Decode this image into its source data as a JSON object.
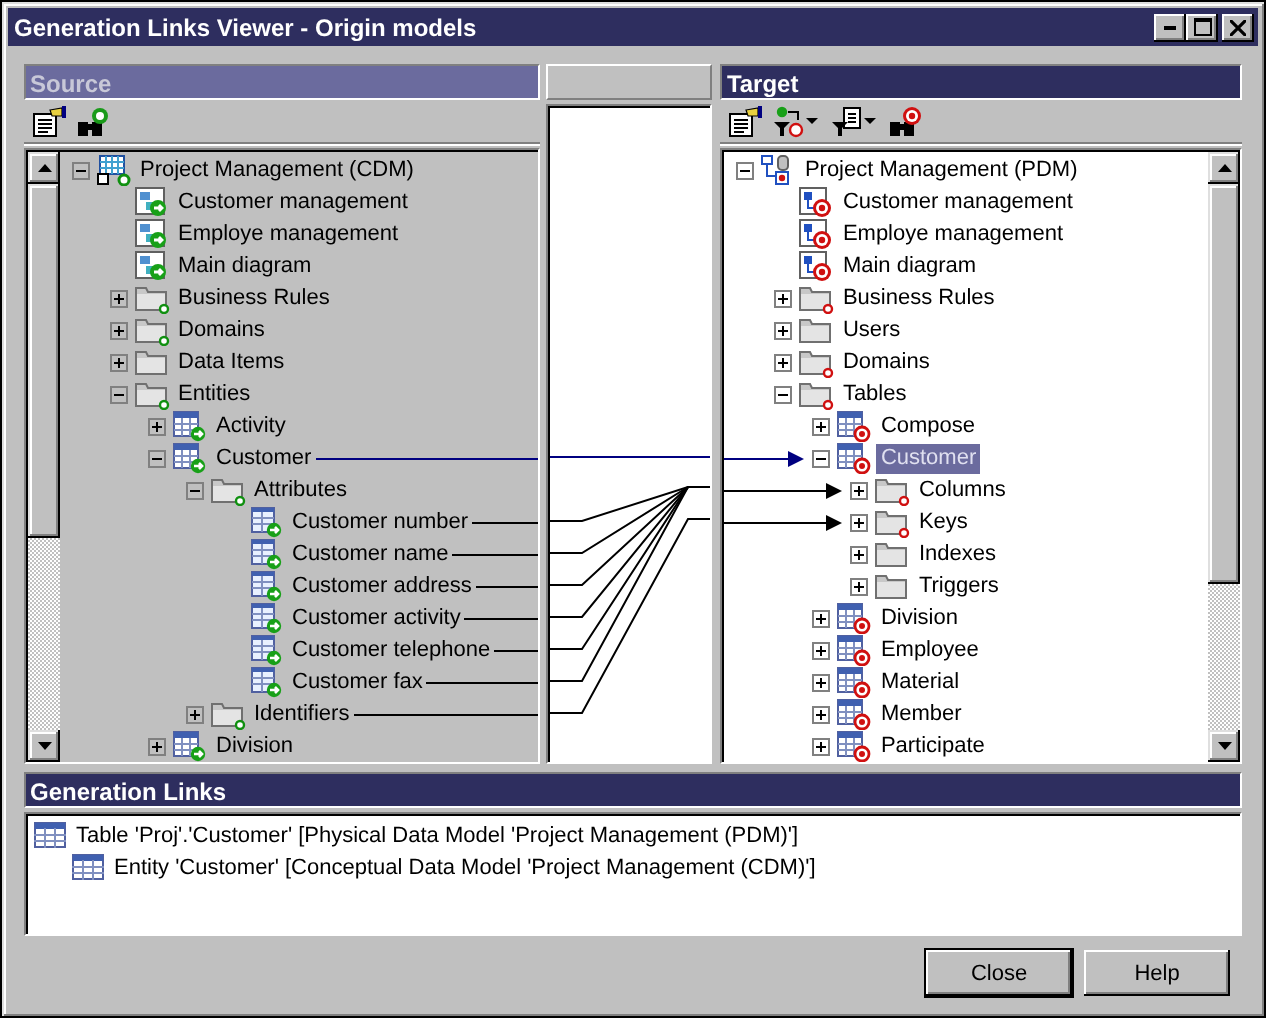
{
  "window": {
    "title": "Generation Links Viewer - Origin models"
  },
  "source": {
    "header": "Source",
    "focused": false,
    "tree": [
      {
        "label": "Project Management (CDM)",
        "kind": "model",
        "expanded": true,
        "children": [
          {
            "label": "Customer management",
            "kind": "diagram"
          },
          {
            "label": "Employe management",
            "kind": "diagram"
          },
          {
            "label": "Main diagram",
            "kind": "diagram"
          },
          {
            "label": "Business Rules",
            "kind": "folder",
            "expanded": false
          },
          {
            "label": "Domains",
            "kind": "folder",
            "expanded": false
          },
          {
            "label": "Data Items",
            "kind": "plainfolder",
            "expanded": false
          },
          {
            "label": "Entities",
            "kind": "folder",
            "expanded": true,
            "children": [
              {
                "label": "Activity",
                "kind": "entity",
                "expanded": false
              },
              {
                "label": "Customer",
                "kind": "entity",
                "expanded": true,
                "linked": true,
                "current_link": true,
                "children": [
                  {
                    "label": "Attributes",
                    "kind": "folder",
                    "expanded": true,
                    "children": [
                      {
                        "label": "Customer number",
                        "kind": "attribute",
                        "linked": true,
                        "current_link": false
                      },
                      {
                        "label": "Customer name",
                        "kind": "attribute",
                        "linked": true,
                        "current_link": false
                      },
                      {
                        "label": "Customer address",
                        "kind": "attribute",
                        "linked": true,
                        "current_link": false
                      },
                      {
                        "label": "Customer activity",
                        "kind": "attribute",
                        "linked": true,
                        "current_link": false
                      },
                      {
                        "label": "Customer telephone",
                        "kind": "attribute",
                        "linked": true,
                        "current_link": false
                      },
                      {
                        "label": "Customer fax",
                        "kind": "attribute",
                        "linked": true,
                        "current_link": false
                      }
                    ]
                  },
                  {
                    "label": "Identifiers",
                    "kind": "folder",
                    "expanded": false,
                    "linked": true,
                    "current_link": false
                  }
                ]
              },
              {
                "label": "Division",
                "kind": "entity",
                "expanded": false
              }
            ]
          }
        ]
      }
    ]
  },
  "target": {
    "header": "Target",
    "focused": true,
    "tree": [
      {
        "label": "Project Management (PDM)",
        "kind": "model",
        "expanded": true,
        "selected": false,
        "children": [
          {
            "label": "Customer management",
            "kind": "diagram",
            "selected": false
          },
          {
            "label": "Employe management",
            "kind": "diagram",
            "selected": false
          },
          {
            "label": "Main diagram",
            "kind": "diagram",
            "selected": false
          },
          {
            "label": "Business Rules",
            "kind": "folder",
            "expanded": false,
            "selected": false
          },
          {
            "label": "Users",
            "kind": "plainfolder",
            "expanded": false,
            "selected": false
          },
          {
            "label": "Domains",
            "kind": "folder",
            "expanded": false,
            "selected": false
          },
          {
            "label": "Tables",
            "kind": "folder",
            "expanded": true,
            "selected": false,
            "children": [
              {
                "label": "Compose",
                "kind": "table",
                "expanded": false,
                "selected": false
              },
              {
                "label": "Customer",
                "kind": "table",
                "expanded": true,
                "selected": true,
                "linked": true,
                "current_link": true,
                "children": [
                  {
                    "label": "Columns",
                    "kind": "folder",
                    "expanded": false,
                    "selected": false,
                    "linked": true,
                    "current_link": false
                  },
                  {
                    "label": "Keys",
                    "kind": "folder",
                    "expanded": false,
                    "selected": false,
                    "linked": true,
                    "current_link": false
                  },
                  {
                    "label": "Indexes",
                    "kind": "plainfolder",
                    "expanded": false,
                    "selected": false
                  },
                  {
                    "label": "Triggers",
                    "kind": "plainfolder",
                    "expanded": false,
                    "selected": false
                  }
                ]
              },
              {
                "label": "Division",
                "kind": "table",
                "expanded": false,
                "selected": false
              },
              {
                "label": "Employee",
                "kind": "table",
                "expanded": false,
                "selected": false
              },
              {
                "label": "Material",
                "kind": "table",
                "expanded": false,
                "selected": false
              },
              {
                "label": "Member",
                "kind": "table",
                "expanded": false,
                "selected": false
              },
              {
                "label": "Participate",
                "kind": "table",
                "expanded": false,
                "selected": false
              }
            ]
          }
        ]
      }
    ]
  },
  "generation_links": {
    "header": "Generation Links",
    "items": [
      {
        "label": "Table 'Proj'.'Customer' [Physical Data Model 'Project Management (PDM)']",
        "children": [
          {
            "label": "Entity 'Customer' [Conceptual Data Model 'Project Management (CDM)']"
          }
        ]
      }
    ]
  },
  "buttons": [
    {
      "label": "Close",
      "default": true
    },
    {
      "label": "Help",
      "default": false
    }
  ]
}
